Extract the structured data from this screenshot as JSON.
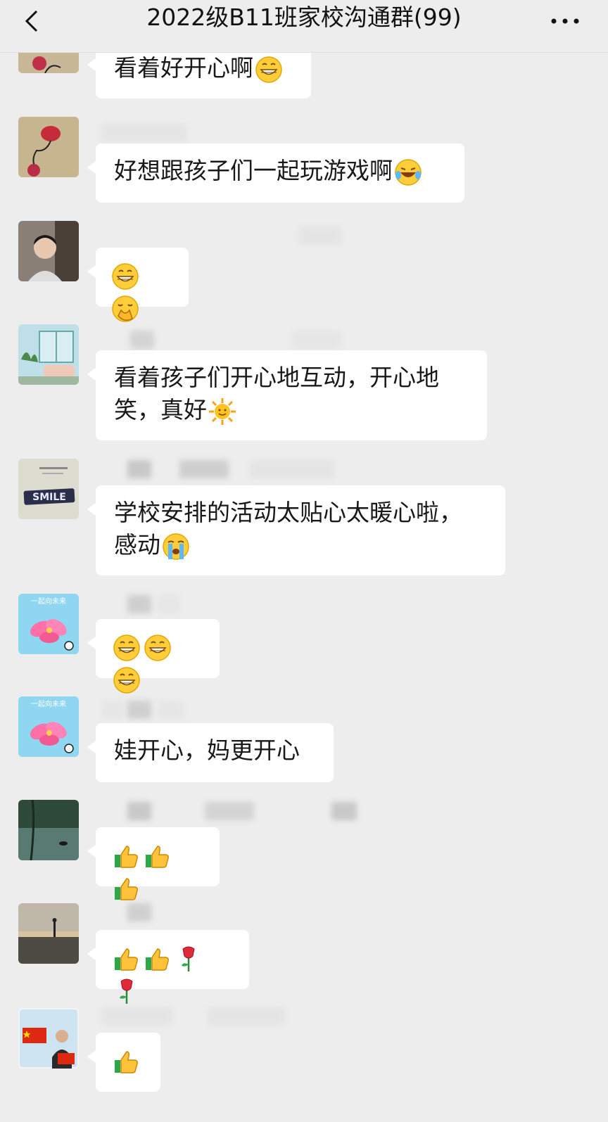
{
  "header": {
    "title": "2022级B11班家校沟通群(99)",
    "back_icon": "chevron-left-icon",
    "more_icon": "more-icon"
  },
  "messages": [
    {
      "text": "看着好开心啊",
      "emojis": [
        "grin"
      ]
    },
    {
      "text": "好想跟孩子们一起玩游戏啊",
      "emojis": [
        "joy"
      ]
    },
    {
      "text": "",
      "emojis": [
        "grin",
        "shy"
      ]
    },
    {
      "text": "看着孩子们开心地互动，开心地",
      "text2": "笑，真好",
      "emojis": [
        "sun"
      ]
    },
    {
      "text": "学校安排的活动太贴心太暖心啦，",
      "text2": "感动",
      "emojis": [
        "sob"
      ]
    },
    {
      "text": "",
      "emojis": [
        "grin",
        "grin",
        "grin"
      ]
    },
    {
      "text": "娃开心，妈更开心",
      "emojis": []
    },
    {
      "text": "",
      "emojis": [
        "thumbs-up",
        "thumbs-up",
        "thumbs-up"
      ]
    },
    {
      "text": "",
      "emojis": [
        "thumbs-up",
        "thumbs-up",
        "rose",
        "rose"
      ]
    },
    {
      "text": "",
      "emojis": [
        "thumbs-up"
      ]
    }
  ],
  "avatars": {
    "smile_text": "SMILE",
    "flower_caption": "一起向未来"
  },
  "colors": {
    "background": "#ededed",
    "bubble": "#ffffff",
    "text": "#191919"
  }
}
